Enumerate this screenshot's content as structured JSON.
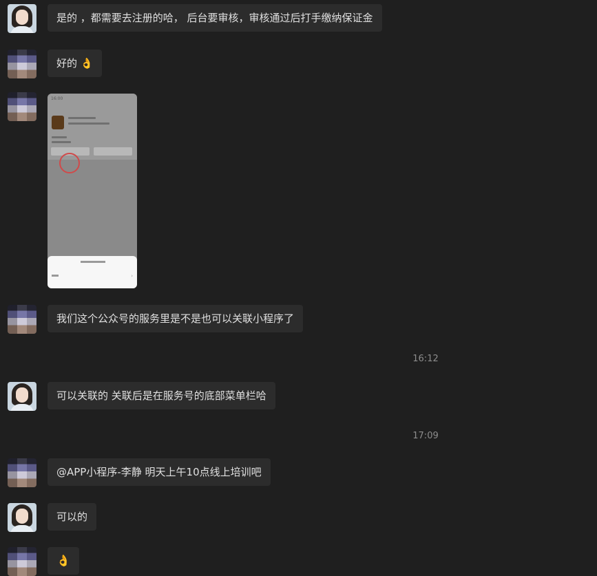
{
  "messages": [
    {
      "sender": "me",
      "text": "是的 ，都需要去注册的哈， 后台要审核，审核通过后打手缴纳保证金"
    },
    {
      "sender": "other",
      "text": "好的 👌"
    },
    {
      "sender": "other",
      "type": "image"
    },
    {
      "sender": "other",
      "text": "我们这个公众号的服务里是不是也可以关联小程序了"
    },
    {
      "type": "time",
      "text": "16:12"
    },
    {
      "sender": "me",
      "text": "可以关联的 关联后是在服务号的底部菜单栏哈"
    },
    {
      "type": "time",
      "text": "17:09"
    },
    {
      "sender": "other",
      "text": "@APP小程序-李静 明天上午10点线上培训吧"
    },
    {
      "sender": "me",
      "text": "可以的"
    },
    {
      "sender": "other",
      "text": "👌"
    }
  ],
  "image_message": {
    "status_time": "16:00"
  }
}
